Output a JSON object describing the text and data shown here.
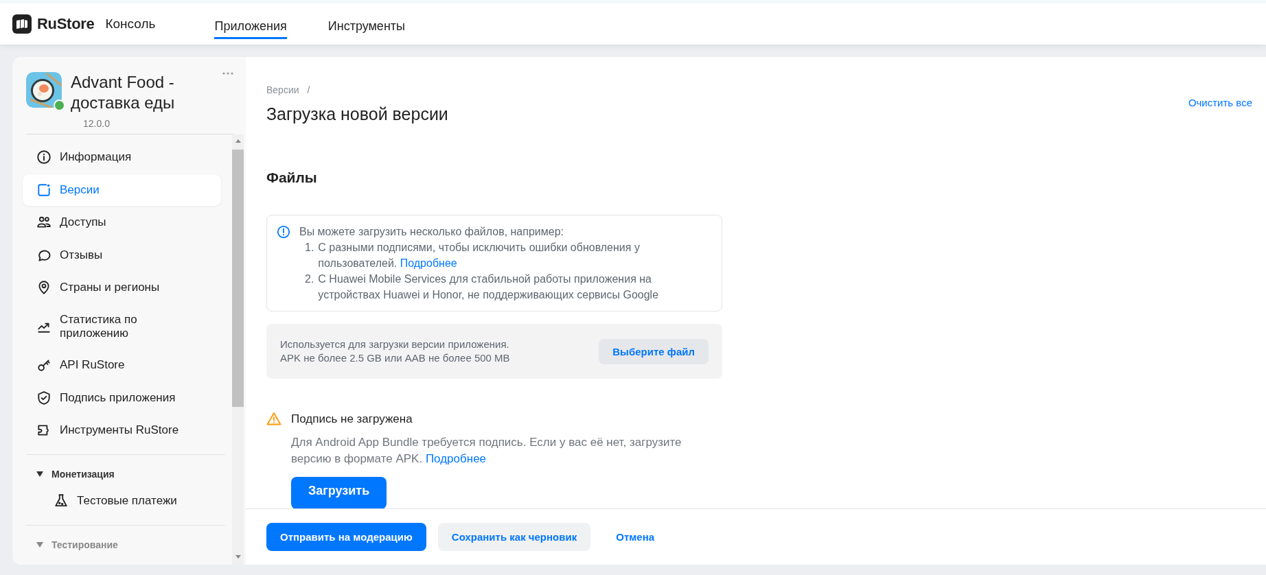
{
  "header": {
    "logo": "RuStore",
    "product": "Консоль",
    "tabs": [
      {
        "label": "Приложения",
        "selected": true
      },
      {
        "label": "Инструменты",
        "selected": false
      }
    ]
  },
  "sidebar": {
    "app": {
      "name": "Advant Food - доставка еды",
      "version": "12.0.0"
    },
    "items": [
      {
        "label": "Информация",
        "kind": "info",
        "selected": false
      },
      {
        "label": "Версии",
        "kind": "versions",
        "selected": true
      },
      {
        "label": "Доступы",
        "kind": "people",
        "selected": false
      },
      {
        "label": "Отзывы",
        "kind": "chat",
        "selected": false
      },
      {
        "label": "Страны и регионы",
        "kind": "pin",
        "selected": false
      },
      {
        "label": "Статистика по приложению",
        "kind": "chart",
        "selected": false
      },
      {
        "label": "API RuStore",
        "kind": "key",
        "selected": false
      },
      {
        "label": "Подпись приложения",
        "kind": "shield",
        "selected": false
      },
      {
        "label": "Инструменты RuStore",
        "kind": "puzzle",
        "selected": false
      }
    ],
    "sections": [
      {
        "label": "Монетизация",
        "expanded": true,
        "items": [
          {
            "label": "Тестовые платежи",
            "kind": "flask",
            "selected": false
          }
        ]
      },
      {
        "label": "Тестирование",
        "expanded": true
      }
    ]
  },
  "main": {
    "breadcrumb": {
      "items": [
        "Версии"
      ],
      "separator": "/"
    },
    "title": "Загрузка новой версии",
    "clear_link": "Очистить все",
    "section_title": "Файлы",
    "info": {
      "intro": "Вы можете загрузить несколько файлов, например:",
      "items": [
        {
          "number": "1.",
          "text": "С разными подписями, чтобы исключить ошибки обновления у пользователей.",
          "link": "Подробнее"
        },
        {
          "number": "2.",
          "text": "С Huawei Mobile Services для стабильной работы приложения на устройствах Huawei и Honor, не поддерживающих сервисы Google"
        }
      ]
    },
    "upload": {
      "lines": [
        "Используется для загрузки версии приложения.",
        "APK не более 2.5 GB или AAB не более 500 MB"
      ],
      "button": "Выберите файл"
    },
    "warning": {
      "title": "Подпись не загружена",
      "text": "Для Android App Bundle требуется подпись. Если у вас её нет, загрузите версию в формате APK.",
      "link": "Подробнее",
      "button": "Загрузить"
    }
  },
  "footer": {
    "buttons": [
      {
        "label": "Отправить на модерацию",
        "kind": "primary"
      },
      {
        "label": "Сохранить как черновик",
        "kind": "secondary"
      },
      {
        "label": "Отмена",
        "kind": "link"
      }
    ]
  }
}
